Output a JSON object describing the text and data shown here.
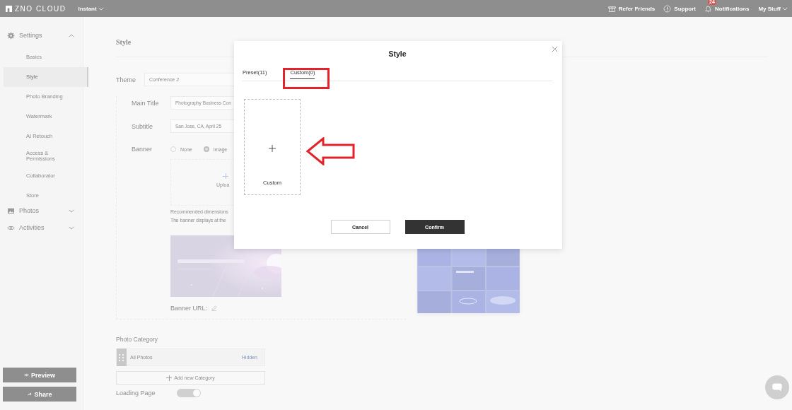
{
  "topbar": {
    "logo": "ZNO CLOUD",
    "workspace": "Instant",
    "links": [
      {
        "label": "Refer Friends"
      },
      {
        "label": "Support"
      },
      {
        "label": "Notifications",
        "badge": "24"
      }
    ],
    "account": "My Stuff"
  },
  "sidebar": {
    "sections": [
      {
        "label": "Settings",
        "expanded": true,
        "children": [
          {
            "label": "Basics",
            "selected": false
          },
          {
            "label": "Style",
            "selected": true
          },
          {
            "label": "Photo Branding",
            "selected": false
          },
          {
            "label": "Watermark",
            "selected": false
          },
          {
            "label": "AI Retouch",
            "selected": false
          },
          {
            "label": "Access & Permissions",
            "selected": false
          },
          {
            "label": "Collaborator",
            "selected": false
          },
          {
            "label": "Store",
            "selected": false
          }
        ]
      },
      {
        "label": "Photos",
        "expanded": false
      },
      {
        "label": "Activities",
        "expanded": false
      }
    ],
    "buttons": [
      {
        "label": "Preview"
      },
      {
        "label": "Share"
      }
    ]
  },
  "page": {
    "title": "Style",
    "theme": {
      "label": "Theme",
      "value": "Conference 2"
    },
    "fields": [
      {
        "label": "Main Title",
        "value": "Photography Business Con"
      },
      {
        "label": "Subtitle",
        "value": "San Jose, CA, April 25"
      }
    ],
    "banner": {
      "label": "Banner",
      "options": [
        {
          "label": "None",
          "selected": false
        },
        {
          "label": "Image",
          "selected": true
        }
      ],
      "upload": "Uploa",
      "notes": [
        "Recommended dimensions",
        "The banner displays at the"
      ],
      "url_label": "Banner URL:"
    },
    "photo_category": {
      "heading": "Photo Category",
      "categories": [
        {
          "name": "All Photos",
          "status": "Hidden"
        }
      ],
      "add_button": "Add new Category"
    },
    "loading_page": {
      "label": "Loading Page",
      "on": true
    }
  },
  "dialog": {
    "title": "Style",
    "tabs": [
      {
        "label": "Preset(11)",
        "selected": false
      },
      {
        "label": "Custom(0)",
        "selected": true
      }
    ],
    "cards": [
      {
        "label": "Custom"
      }
    ],
    "buttons": [
      {
        "label": "Cancel",
        "kind": "secondary"
      },
      {
        "label": "Confirm",
        "kind": "primary"
      }
    ]
  }
}
